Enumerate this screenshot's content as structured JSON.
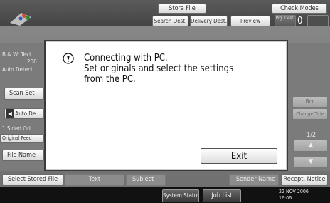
{
  "top": {
    "store_file": "Store File",
    "check_modes": "Check Modes",
    "search_dest": "Search Dest.",
    "delivery_dest": "Delivery Dest.",
    "preview": "Preview",
    "prg_dest": "Prg. Dest.",
    "counter": "0"
  },
  "left": {
    "bw_text": "B & W: Text",
    "dpi": "200",
    "auto_detect": "Auto Detect",
    "scan_settings": "Scan Set",
    "auto_density": "Auto De",
    "sided": "1 Sided Ori",
    "original_feed": "Original Feed",
    "file_name": "File Name"
  },
  "right": {
    "bcc": "Bcc",
    "change_title": "Change Title",
    "page": "1/2"
  },
  "dialog": {
    "line1": "Connecting with PC.",
    "line2": "Set originals and select the settings",
    "line3": "from the PC.",
    "exit": "Exit"
  },
  "row": {
    "select_stored_file": "Select Stored File",
    "text": "Text",
    "subject": "Subject",
    "sender_name": "Sender Name",
    "recept_notice": "Recept. Notice"
  },
  "status": {
    "system_status": "System Status",
    "job_list": "Job List",
    "date": "22 NOV 2006",
    "time": "16:06"
  }
}
